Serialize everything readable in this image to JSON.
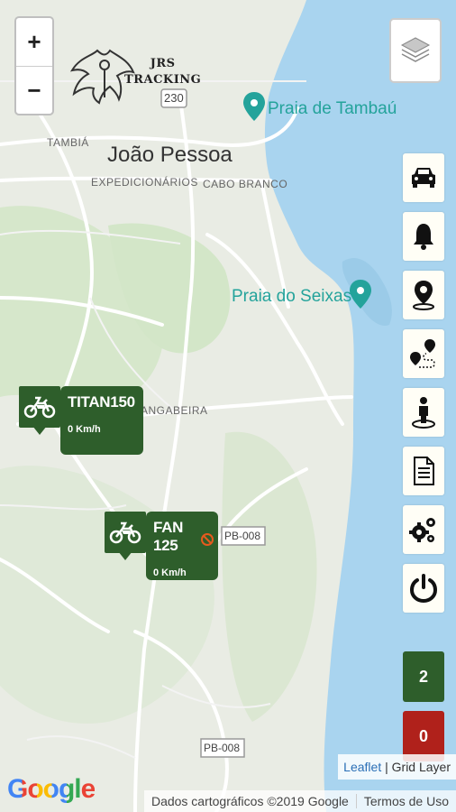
{
  "map": {
    "labels": {
      "city": "João Pessoa",
      "tambia": "TAMBIÁ",
      "expedicionarios": "EXPEDICIONÁRIOS",
      "cabo_branco": "CABO BRANCO",
      "mangabeira": "ANGABEIRA",
      "praia_tambau": "Praia de Tambaú",
      "praia_seixas": "Praia do Seixas",
      "route_230": "230",
      "pb008_upper": "PB-008",
      "pb008_lower": "PB-008"
    },
    "colors": {
      "water": "#a9d4ef",
      "land": "#e9ece4",
      "green_area": "#d3e6c8",
      "road": "#ffffff",
      "marker": "#2e5e2b",
      "alert": "#b0211b"
    }
  },
  "zoom": {
    "in": "+",
    "out": "−"
  },
  "logo": {
    "line1": "JRS",
    "line2": "TRACKING"
  },
  "toolbar": [
    {
      "icon": "car-icon"
    },
    {
      "icon": "bell-icon"
    },
    {
      "icon": "map-pin-icon"
    },
    {
      "icon": "route-icon"
    },
    {
      "icon": "person-location-icon"
    },
    {
      "icon": "document-icon"
    },
    {
      "icon": "gears-icon"
    },
    {
      "icon": "power-icon"
    }
  ],
  "counts": {
    "online": "2",
    "offline": "0"
  },
  "vehicles": [
    {
      "name": "TITAN150",
      "speed": "0 Km/h"
    },
    {
      "name": "FAN 125",
      "speed": "0 Km/h"
    }
  ],
  "attribution": {
    "leaflet": "Leaflet",
    "separator": " | ",
    "layer": "Grid Layer"
  },
  "footer": {
    "google": "Google",
    "data": "Dados cartográficos ©2019 Google",
    "terms": "Termos de Uso"
  }
}
